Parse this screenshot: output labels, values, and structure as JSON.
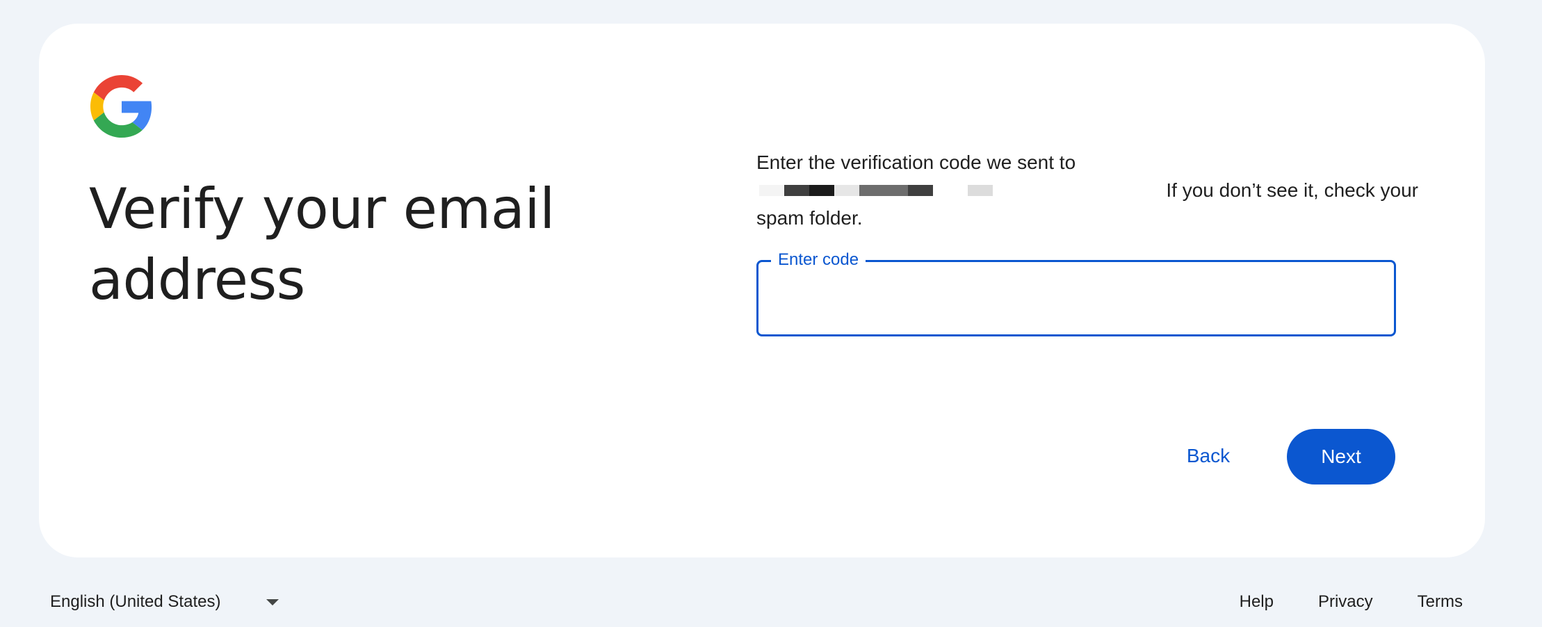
{
  "heading": "Verify your email address",
  "instructions": {
    "line1": "Enter the verification code we sent to",
    "line2": "If you don’t see it, check your",
    "line3": "spam folder."
  },
  "code_field": {
    "label": "Enter code",
    "value": ""
  },
  "buttons": {
    "back": "Back",
    "next": "Next"
  },
  "footer": {
    "language": "English (United States)",
    "help": "Help",
    "privacy": "Privacy",
    "terms": "Terms"
  },
  "colors": {
    "background": "#f0f4f9",
    "accent": "#0b57d0",
    "logo_red": "#ea4335",
    "logo_yellow": "#fbbc05",
    "logo_green": "#34a853",
    "logo_blue": "#4285f4"
  },
  "icons": {
    "logo": "google-logo-icon",
    "language_dropdown": "caret-down-icon"
  }
}
